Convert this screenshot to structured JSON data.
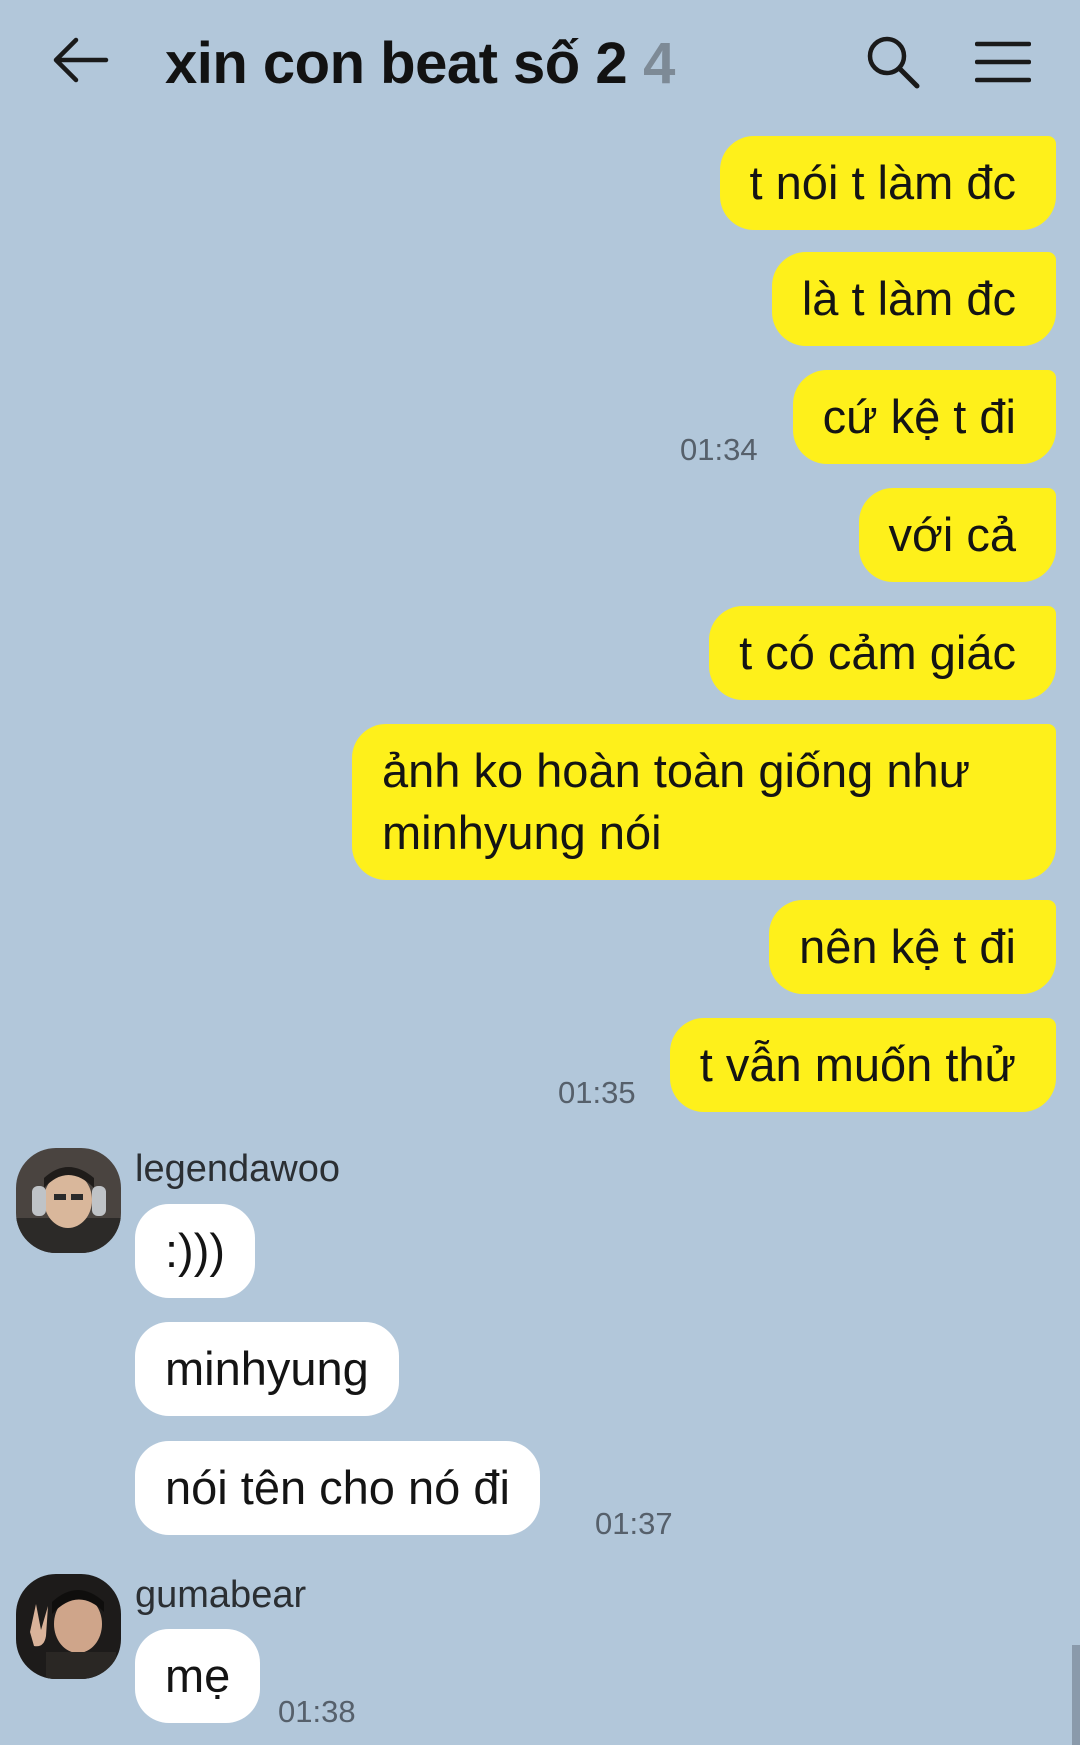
{
  "header": {
    "title": "xin con beat số 2",
    "member_count": "4"
  },
  "messages": {
    "out": [
      {
        "text": "t nói t làm đc"
      },
      {
        "text": "là t làm đc"
      },
      {
        "text": "cứ kệ t đi",
        "time": "01:34"
      },
      {
        "text": "với cả"
      },
      {
        "text": "t có cảm giác"
      },
      {
        "text": "ảnh ko hoàn toàn giống như minhyung nói"
      },
      {
        "text": "nên kệ t đi"
      },
      {
        "text": "t vẫn muốn thử",
        "time": "01:35"
      }
    ],
    "in_group_1": {
      "sender": "legendawoo",
      "items": [
        {
          "text": ":)))"
        },
        {
          "text": "minhyung"
        },
        {
          "text": "nói tên cho nó đi",
          "time": "01:37"
        }
      ]
    },
    "in_group_2": {
      "sender": "gumabear",
      "items": [
        {
          "text": "mẹ",
          "time": "01:38"
        }
      ]
    }
  },
  "colors": {
    "background": "#b2c7da",
    "outgoing_bubble": "#fef01b",
    "incoming_bubble": "#ffffff"
  },
  "icons": [
    "back-arrow-icon",
    "search-icon",
    "menu-icon"
  ]
}
